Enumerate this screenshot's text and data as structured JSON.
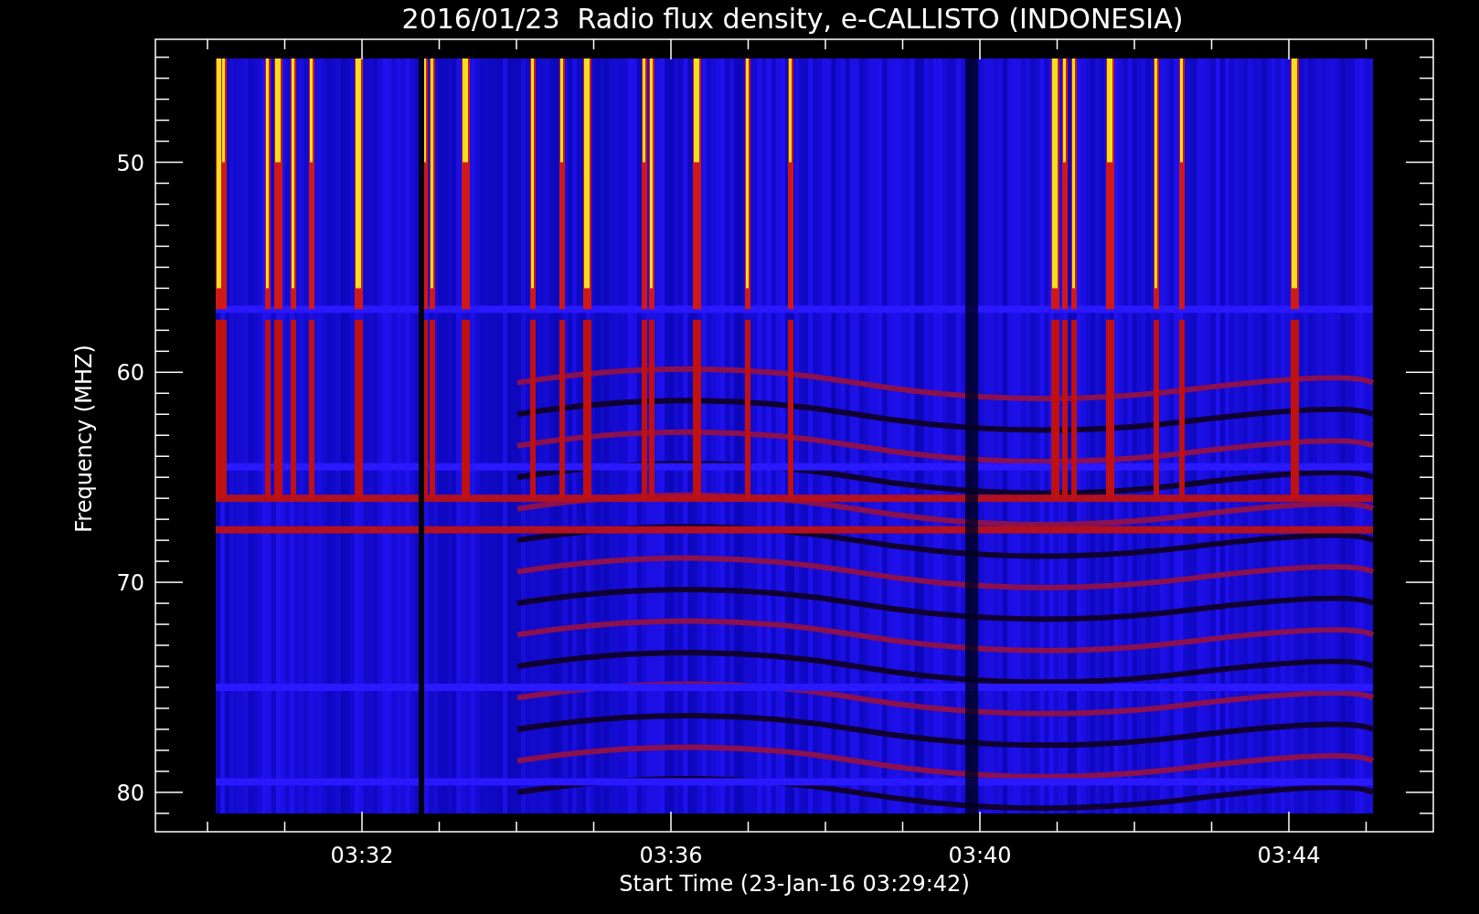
{
  "title": "2016/01/23  Radio flux density, e-CALLISTO (INDONESIA)",
  "y_axis": {
    "label": "Frequency (MHZ)",
    "ticks": [
      "50",
      "60",
      "70",
      "80"
    ]
  },
  "x_axis": {
    "label": "Start Time (23-Jan-16 03:29:42)",
    "ticks": [
      "03:32",
      "03:36",
      "03:40",
      "03:44"
    ]
  }
}
